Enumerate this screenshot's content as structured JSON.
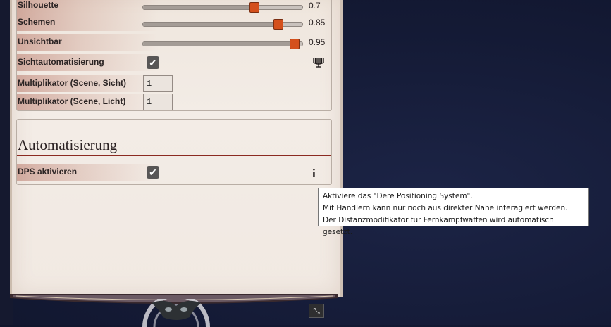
{
  "vision": {
    "sliders": [
      {
        "label": "Silhouette",
        "value": 0.7,
        "display": "0.7"
      },
      {
        "label": "Schemen",
        "value": 0.85,
        "display": "0.85"
      },
      {
        "label": "Unsichtbar",
        "value": 0.95,
        "display": "0.95"
      }
    ],
    "automation_label": "Sichtautomatisierung",
    "automation_checked": true,
    "automation_icon": "menorah-icon",
    "mult_sight_label": "Multiplikator (Scene, Sicht)",
    "mult_sight_value": "1",
    "mult_light_label": "Multiplikator (Scene, Licht)",
    "mult_light_value": "1"
  },
  "automation": {
    "title": "Automatisierung",
    "dps_label": "DPS aktivieren",
    "dps_checked": true,
    "info_icon": "info-icon"
  },
  "tooltip": {
    "line1": "Aktiviere das \"Dere Positioning System\".",
    "line2": "Mit Händlern kann nur noch aus direkter Nähe interagiert werden.",
    "line3": "Der Distanzmodifikator für Fernkampfwaffen wird automatisch gesetzt."
  },
  "colors": {
    "accent": "#d4501c",
    "rule": "#8b2a21",
    "background": "#141a35"
  }
}
